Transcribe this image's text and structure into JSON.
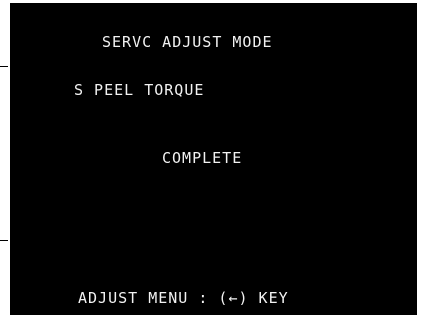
{
  "screen": {
    "title": "SERVC ADJUST MODE",
    "item": "S PEEL TORQUE",
    "status": "COMPLETE",
    "footer": "ADJUST MENU : (←) KEY"
  },
  "colors": {
    "background": "#000000",
    "text": "#f2f2f2"
  }
}
